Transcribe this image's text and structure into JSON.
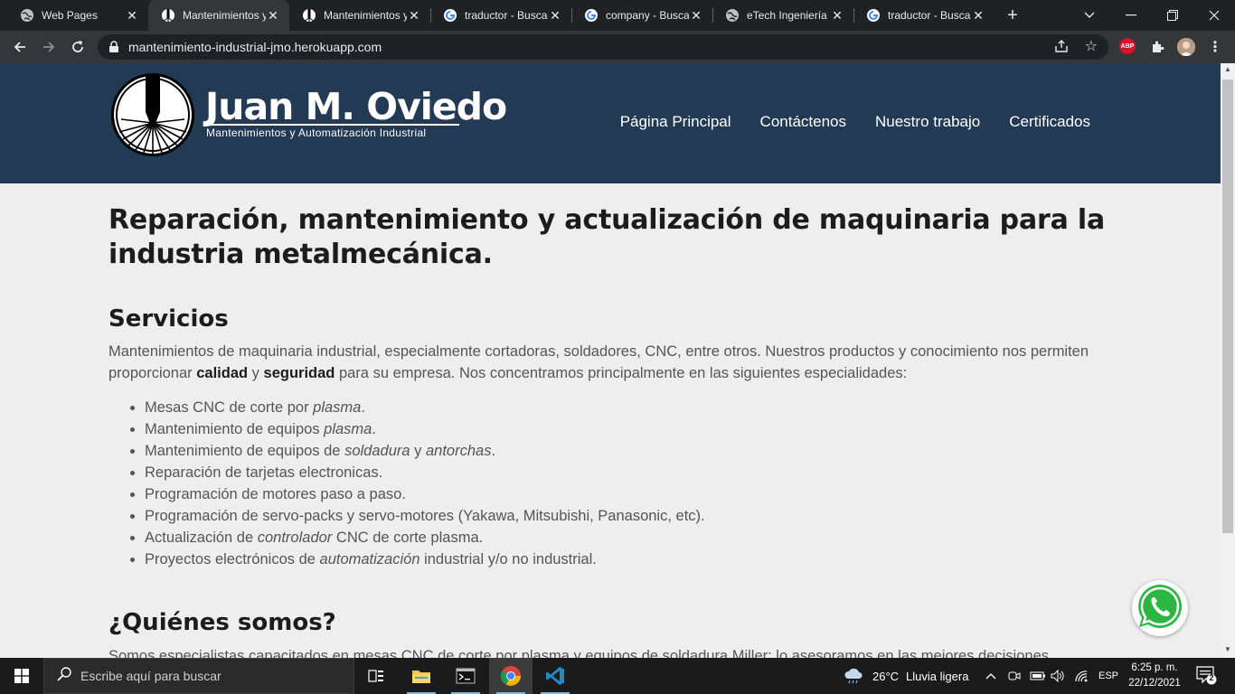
{
  "browser": {
    "tabs": [
      {
        "title": "Web Pages",
        "favicon": "globe-icon",
        "active": false
      },
      {
        "title": "Mantenimientos y",
        "favicon": "jmo-icon",
        "active": true
      },
      {
        "title": "Mantenimientos y",
        "favicon": "jmo-icon",
        "active": false
      },
      {
        "title": "traductor - Busca",
        "favicon": "google-icon",
        "active": false
      },
      {
        "title": "company - Busca",
        "favicon": "google-icon",
        "active": false
      },
      {
        "title": "eTech Ingeniería",
        "favicon": "globe-icon",
        "active": false
      },
      {
        "title": "traductor - Busca",
        "favicon": "google-icon",
        "active": false
      }
    ],
    "url": "mantenimiento-industrial-jmo.herokuapp.com",
    "extensions": {
      "abp_label": "ABP"
    }
  },
  "site": {
    "brand": {
      "name": "Juan M. Oviedo",
      "tagline": "Mantenimientos y Automatización Industrial"
    },
    "nav": [
      {
        "label": "Página Principal"
      },
      {
        "label": "Contáctenos"
      },
      {
        "label": "Nuestro trabajo"
      },
      {
        "label": "Certificados"
      }
    ],
    "hero_title": "Reparación, mantenimiento y actualización de maquinaria para la industria metalmecánica.",
    "services": {
      "heading": "Servicios",
      "intro_1": "Mantenimientos de maquinaria industrial, especialmente cortadoras, soldadores, CNC, entre otros. Nuestros productos y conocimiento nos permiten proporcionar ",
      "intro_bold_1": "calidad",
      "intro_2": " y ",
      "intro_bold_2": "seguridad",
      "intro_3": " para su empresa. Nos concentramos principalmente en las siguientes especialidades:",
      "items": [
        {
          "pre": "Mesas CNC de corte por ",
          "em": "plasma",
          "post": "."
        },
        {
          "pre": "Mantenimiento de equipos ",
          "em": "plasma",
          "post": "."
        },
        {
          "pre": "Mantenimiento de equipos de ",
          "em": "soldadura",
          "mid": " y ",
          "em2": "antorchas",
          "post": "."
        },
        {
          "pre": "Reparación de tarjetas electronicas.",
          "em": "",
          "post": ""
        },
        {
          "pre": "Programación de motores paso a paso.",
          "em": "",
          "post": ""
        },
        {
          "pre": "Programación de servo-packs y servo-motores (Yakawa, Mitsubishi, Panasonic, etc).",
          "em": "",
          "post": ""
        },
        {
          "pre": "Actualización de ",
          "em": "controlador",
          "post": " CNC de corte plasma."
        },
        {
          "pre": "Proyectos electrónicos de ",
          "em": "automatización",
          "post": " industrial y/o no industrial."
        }
      ]
    },
    "about": {
      "heading": "¿Quiénes somos?",
      "text": "Somos especialistas capacitados en mesas CNC de corte por plasma y equipos de soldadura Miller; lo asesoramos en las mejores decisiones"
    }
  },
  "taskbar": {
    "search_placeholder": "Escribe aquí para buscar",
    "weather_temp": "26°C",
    "weather_desc": "Lluvia ligera",
    "language": "ESP",
    "time": "6:25 p. m.",
    "date": "22/12/2021",
    "notification_count": "2"
  }
}
